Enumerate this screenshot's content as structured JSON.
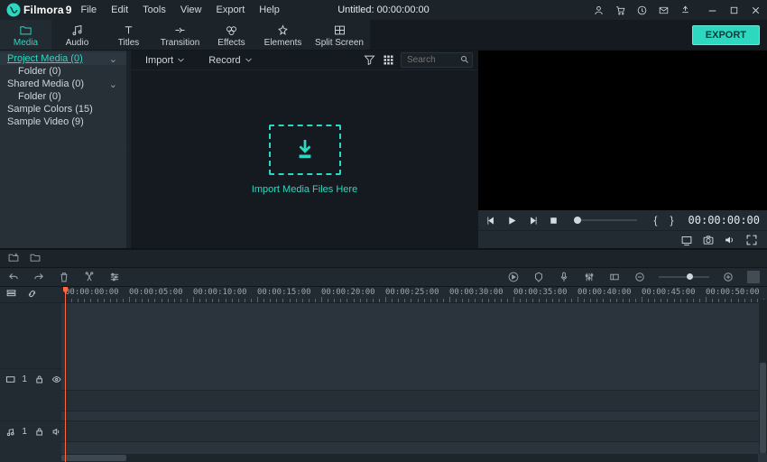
{
  "app": {
    "logo_text": "Filmora",
    "logo_suffix": "9"
  },
  "menu": [
    "File",
    "Edit",
    "Tools",
    "View",
    "Export",
    "Help"
  ],
  "title": "Untitled:  00:00:00:00",
  "tabs": [
    {
      "id": "media",
      "label": "Media"
    },
    {
      "id": "audio",
      "label": "Audio"
    },
    {
      "id": "titles",
      "label": "Titles"
    },
    {
      "id": "transition",
      "label": "Transition"
    },
    {
      "id": "effects",
      "label": "Effects"
    },
    {
      "id": "elements",
      "label": "Elements"
    },
    {
      "id": "split",
      "label": "Split Screen"
    }
  ],
  "export_label": "EXPORT",
  "tree": [
    {
      "label": "Project Media (0)",
      "sel": true,
      "caret": true,
      "indent": 0
    },
    {
      "label": "Folder (0)",
      "indent": 1
    },
    {
      "label": "Shared Media (0)",
      "caret": true,
      "indent": 0
    },
    {
      "label": "Folder (0)",
      "indent": 1
    },
    {
      "label": "Sample Colors (15)",
      "indent": 0
    },
    {
      "label": "Sample Video (9)",
      "indent": 0
    }
  ],
  "mid": {
    "import": "Import",
    "record": "Record",
    "search_placeholder": "Search",
    "drop_text": "Import Media Files Here"
  },
  "preview": {
    "timecode": "00:00:00:00"
  },
  "timeline": {
    "marks": [
      "00:00:00:00",
      "00:00:05:00",
      "00:00:10:00",
      "00:00:15:00",
      "00:00:20:00",
      "00:00:25:00",
      "00:00:30:00",
      "00:00:35:00",
      "00:00:40:00",
      "00:00:45:00",
      "00:00:50:00"
    ],
    "video_track_index": "1",
    "audio_track_index": "1"
  }
}
